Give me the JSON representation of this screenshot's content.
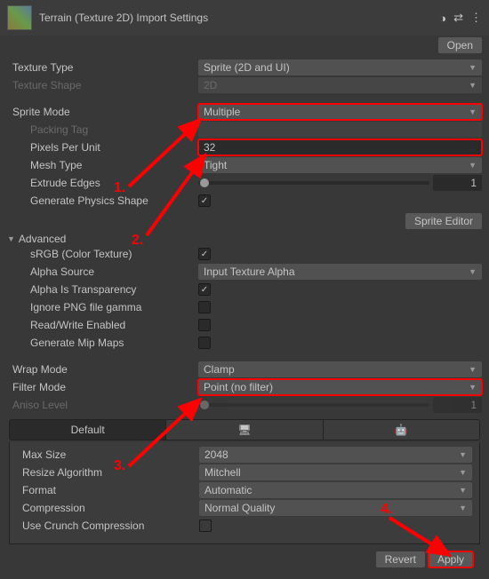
{
  "header": {
    "title": "Terrain (Texture 2D) Import Settings",
    "open": "Open"
  },
  "textureType": {
    "label": "Texture Type",
    "value": "Sprite (2D and UI)"
  },
  "textureShape": {
    "label": "Texture Shape",
    "value": "2D"
  },
  "spriteMode": {
    "label": "Sprite Mode",
    "value": "Multiple"
  },
  "packingTag": {
    "label": "Packing Tag",
    "value": ""
  },
  "pixelsPerUnit": {
    "label": "Pixels Per Unit",
    "value": "32"
  },
  "meshType": {
    "label": "Mesh Type",
    "value": "Tight"
  },
  "extrudeEdges": {
    "label": "Extrude Edges",
    "value": "1"
  },
  "generatePhysicsShape": {
    "label": "Generate Physics Shape"
  },
  "spriteEditor": "Sprite Editor",
  "advanced": {
    "label": "Advanced"
  },
  "srgb": {
    "label": "sRGB (Color Texture)"
  },
  "alphaSource": {
    "label": "Alpha Source",
    "value": "Input Texture Alpha"
  },
  "alphaTransparency": {
    "label": "Alpha Is Transparency"
  },
  "ignorePng": {
    "label": "Ignore PNG file gamma"
  },
  "readWrite": {
    "label": "Read/Write Enabled"
  },
  "generateMipMaps": {
    "label": "Generate Mip Maps"
  },
  "wrapMode": {
    "label": "Wrap Mode",
    "value": "Clamp"
  },
  "filterMode": {
    "label": "Filter Mode",
    "value": "Point (no filter)"
  },
  "anisoLevel": {
    "label": "Aniso Level",
    "value": "1"
  },
  "tabs": {
    "default": "Default"
  },
  "maxSize": {
    "label": "Max Size",
    "value": "2048"
  },
  "resizeAlgorithm": {
    "label": "Resize Algorithm",
    "value": "Mitchell"
  },
  "format": {
    "label": "Format",
    "value": "Automatic"
  },
  "compression": {
    "label": "Compression",
    "value": "Normal Quality"
  },
  "useCrunch": {
    "label": "Use Crunch Compression"
  },
  "revert": "Revert",
  "apply": "Apply",
  "annotations": {
    "a1": "1.",
    "a2": "2.",
    "a3": "3.",
    "a4": "4."
  }
}
